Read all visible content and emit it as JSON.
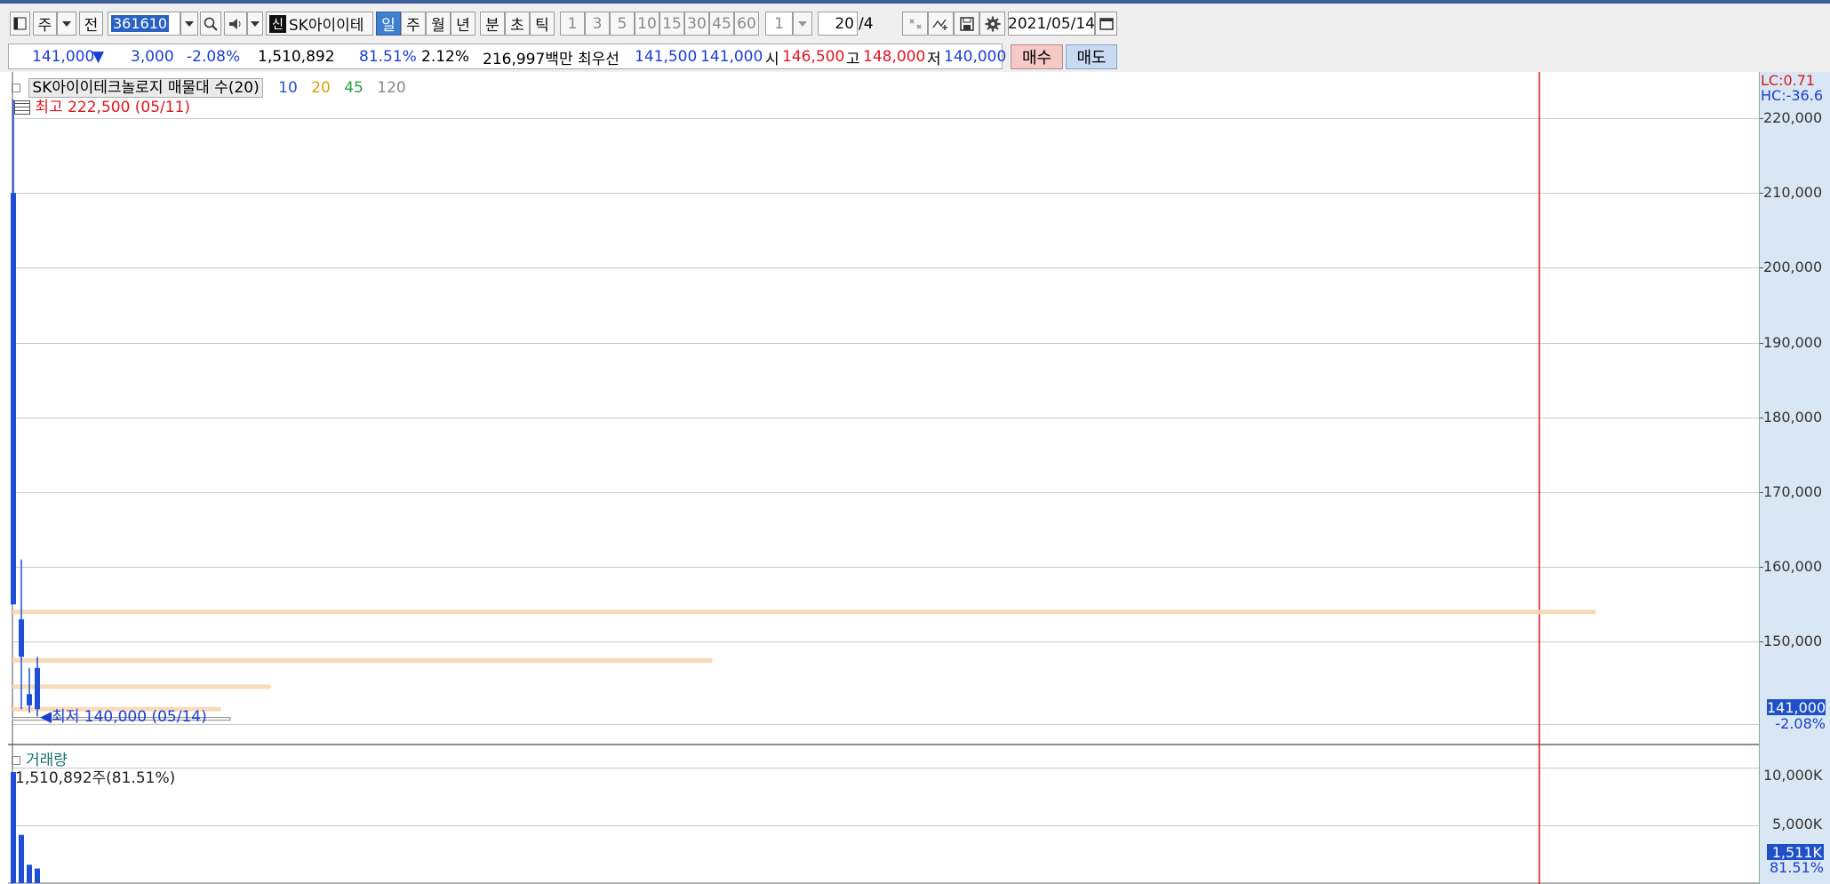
{
  "toolbar": {
    "market_label": "주",
    "prev_label": "전",
    "stock_code": "361610",
    "shin_badge": "신",
    "stock_name": "SK아이이테",
    "period_buttons": [
      "일",
      "주",
      "월",
      "년",
      "분",
      "초",
      "틱"
    ],
    "minute_buttons": [
      "1",
      "3",
      "5",
      "10",
      "15",
      "30",
      "45",
      "60"
    ],
    "unit_value": "1",
    "count_value": "20",
    "count_suffix": "/4",
    "date_value": "2021/05/14"
  },
  "quote": {
    "price": "141,000",
    "change_arrow": "▼",
    "change": "3,000",
    "change_pct": "-2.08%",
    "volume": "1,510,892",
    "volume_pct": "81.51%",
    "turnover_pct": "2.12%",
    "trade_value": "216,997백만",
    "best_label": "최우선",
    "best_ask": "141,500",
    "best_bid": "141,000",
    "open_label": "시",
    "open": "146,500",
    "high_label": "고",
    "high": "148,000",
    "low_label": "저",
    "low": "140,000",
    "buy_label": "매수",
    "sell_label": "매도"
  },
  "chart": {
    "title": "SK아이이테크놀로지 매물대 수(20)",
    "ma_labels": [
      {
        "text": "10",
        "color": "#2a4fd0"
      },
      {
        "text": "20",
        "color": "#e0a000"
      },
      {
        "text": "45",
        "color": "#22a040"
      },
      {
        "text": "120",
        "color": "#888888"
      }
    ],
    "high_annotation": "최고 222,500 (05/11)",
    "low_annotation": "최저 140,000 (05/14)",
    "lc_label": "LC:0.71",
    "hc_label": "HC:-36.6",
    "price_axis_ticks": [
      "220,000",
      "210,000",
      "200,000",
      "190,000",
      "180,000",
      "170,000",
      "160,000",
      "150,000"
    ],
    "current_price_tag": "141,000",
    "current_change_tag": "-2.08%",
    "volume_title": "거래량",
    "volume_annotation": "1,510,892주(81.51%)",
    "volume_axis_ticks": [
      "10,000K",
      "5,000K"
    ],
    "current_volume_tag": "1,511K",
    "current_volume_pct_tag": "81.51%",
    "colors": {
      "down": "#1e50d6",
      "up": "#e0161d",
      "volume_profile": "#f8d9b8",
      "cursor": "#e0161d"
    }
  },
  "chart_data": {
    "type": "candlestick",
    "price_ylim": [
      137000,
      223000
    ],
    "candles": [
      {
        "open": 210000,
        "high": 222500,
        "low": 155000,
        "close": 155000
      },
      {
        "open": 153000,
        "high": 161000,
        "low": 141000,
        "close": 148000
      },
      {
        "open": 143000,
        "high": 146500,
        "low": 140500,
        "close": 141500
      },
      {
        "open": 146500,
        "high": 148000,
        "low": 140000,
        "close": 141000
      }
    ],
    "volume_ylim": [
      0,
      11500
    ],
    "volumes_k": [
      11500,
      5000,
      1900,
      1511
    ],
    "volume_profile_levels": [
      {
        "price": 154000,
        "rel": 0.95
      },
      {
        "price": 147500,
        "rel": 0.42
      },
      {
        "price": 144000,
        "rel": 0.155
      },
      {
        "price": 141000,
        "rel": 0.125
      }
    ]
  }
}
